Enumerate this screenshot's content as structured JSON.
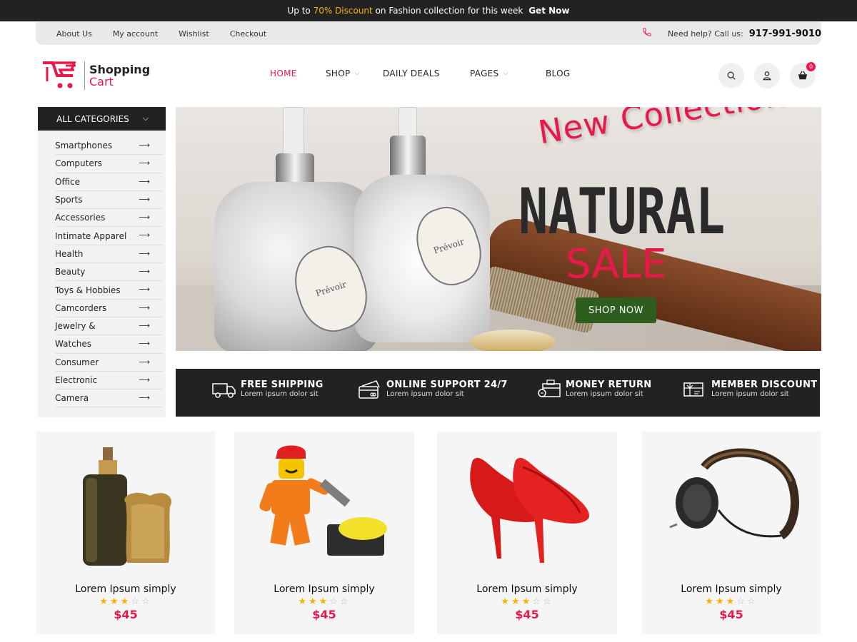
{
  "announcement": {
    "prefix": "Up to ",
    "highlight": "70% Discount",
    "suffix": " on Fashion collection for this week ",
    "cta": "Get Now"
  },
  "topbar": {
    "links": [
      "About Us",
      "My account",
      "Wishlist",
      "Checkout"
    ],
    "help_label": "Need help? Call us:",
    "phone": "917-991-9010"
  },
  "logo": {
    "line1": "Shopping",
    "line2": "Cart"
  },
  "nav": [
    {
      "label": "HOME",
      "active": true
    },
    {
      "label": "SHOP",
      "dropdown": true
    },
    {
      "label": "DAILY DEALS"
    },
    {
      "label": "PAGES",
      "dropdown": true
    },
    {
      "label": "BLOG"
    }
  ],
  "cart": {
    "count": "0"
  },
  "categories": {
    "title": "ALL CATEGORIES",
    "items": [
      "Smartphones",
      "Computers",
      "Office",
      "Sports",
      "Accessories",
      "Intimate Apparel",
      "Health",
      "Beauty",
      "Toys & Hobbies",
      "Camcorders",
      "Jewelry &",
      "Watches",
      "Consumer",
      "Electronic",
      "Camera"
    ]
  },
  "hero": {
    "line1": "New Collection",
    "line2": "NATURAL",
    "line3": "SALE",
    "button": "SHOP NOW",
    "label_text": "Prévoir"
  },
  "features": [
    {
      "title": "FREE SHIPPING",
      "subtitle": "Lorem ipsum dolor sit",
      "icon": "truck-icon"
    },
    {
      "title": "ONLINE SUPPORT 24/7",
      "subtitle": "Lorem ipsum dolor sit",
      "icon": "credit-card-icon"
    },
    {
      "title": "MONEY RETURN",
      "subtitle": "Lorem ipsum dolor sit",
      "icon": "money-return-icon"
    },
    {
      "title": "MEMBER DISCOUNT",
      "subtitle": "Lorem ipsum dolor sit",
      "icon": "gift-card-icon"
    }
  ],
  "products": [
    {
      "name": "Lorem Ipsum simply",
      "price": "$45",
      "rating": 3,
      "max_rating": 5,
      "image": "perfume-bottle"
    },
    {
      "name": "Lorem Ipsum simply",
      "price": "$45",
      "rating": 3,
      "max_rating": 5,
      "image": "toy-figure"
    },
    {
      "name": "Lorem Ipsum simply",
      "price": "$45",
      "rating": 3,
      "max_rating": 5,
      "image": "red-heels"
    },
    {
      "name": "Lorem Ipsum simply",
      "price": "$45",
      "rating": 3,
      "max_rating": 5,
      "image": "headphones"
    }
  ],
  "colors": {
    "accent": "#e8184a",
    "dark": "#222222",
    "button_green": "#2d5e1e",
    "star": "#f5b400"
  }
}
